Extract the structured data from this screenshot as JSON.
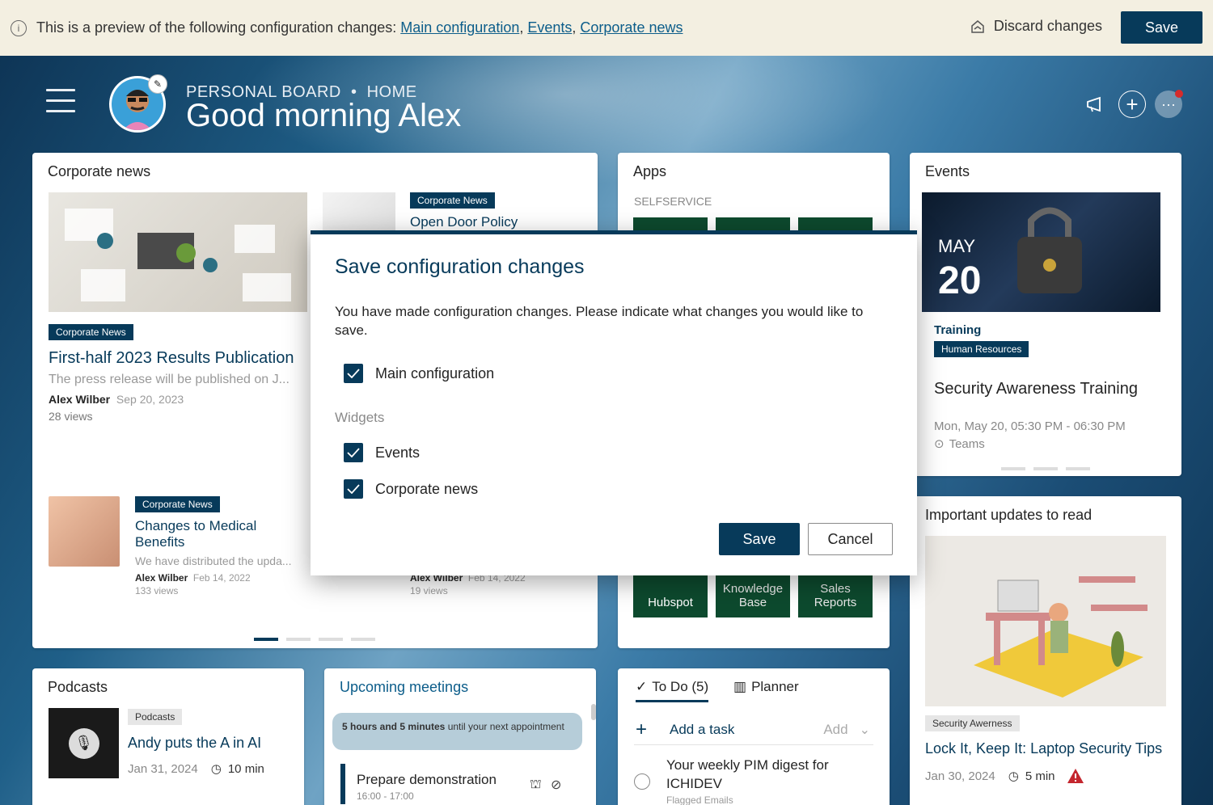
{
  "banner": {
    "message": "This is a preview of the following configuration changes: ",
    "links": [
      "Main configuration",
      "Events",
      "Corporate news"
    ],
    "sep": ", ",
    "discard_label": "Discard changes",
    "save_label": "Save"
  },
  "header": {
    "crumb_section": "PERSONAL BOARD",
    "crumb_page": "HOME",
    "greeting": "Good morning Alex"
  },
  "corporate_news": {
    "title": "Corporate news",
    "featured": {
      "tag": "Corporate News",
      "headline": "First-half 2023 Results Publication",
      "excerpt": "The press release will be published on J...",
      "author": "Alex Wilber",
      "date": "Sep 20, 2023",
      "views": "28 views"
    },
    "side": {
      "tag": "Corporate News",
      "headline": "Open Door Policy"
    },
    "second": {
      "tag": "Corporate News",
      "headline": "Changes to Medical Benefits",
      "excerpt": "We have distributed the upda...",
      "author": "Alex Wilber",
      "date": "Feb 14, 2022",
      "views": "133 views"
    },
    "third": {
      "author": "Alex Wilber",
      "date": "Feb 14, 2022",
      "views": "19 views"
    }
  },
  "apps": {
    "title": "Apps",
    "group": "SELFSERVICE",
    "tiles": [
      "Hubspot",
      "Knowledge Base",
      "Sales Reports"
    ]
  },
  "events": {
    "title": "Events",
    "month": "MAY",
    "day": "20",
    "category": "Training",
    "tag": "Human Resources",
    "name": "Security Awareness Training",
    "time": "Mon, May 20, 05:30 PM - 06:30 PM",
    "location": "Teams"
  },
  "updates": {
    "title": "Important updates to read",
    "tag": "Security Awerness",
    "headline": "Lock It, Keep It: Laptop Security Tips",
    "date": "Jan 30, 2024",
    "duration": "5 min"
  },
  "podcasts": {
    "title": "Podcasts",
    "tag": "Podcasts",
    "episode": "Andy puts the A in AI",
    "date": "Jan 31, 2024",
    "duration": "10 min"
  },
  "meetings": {
    "title": "Upcoming meetings",
    "notice_bold": "5 hours and 5 minutes",
    "notice_rest": " until your next appointment",
    "item_title": "Prepare demonstration",
    "item_time": "16:00 - 17:00"
  },
  "todo": {
    "tab_todo": "To Do (5)",
    "tab_planner": "Planner",
    "add_task": "Add a task",
    "add_label": "Add",
    "task_text": "Your weekly PIM digest for ICHIDEV",
    "task_sub": "Flagged Emails"
  },
  "modal": {
    "title": "Save configuration changes",
    "description": "You have made configuration changes. Please indicate what changes you would like to save.",
    "main_option": "Main configuration",
    "widgets_heading": "Widgets",
    "widget_options": [
      "Events",
      "Corporate news"
    ],
    "save_label": "Save",
    "cancel_label": "Cancel"
  },
  "colors": {
    "primary": "#073a5a",
    "banner_bg": "#f3efe1",
    "alert": "#c4262e"
  }
}
